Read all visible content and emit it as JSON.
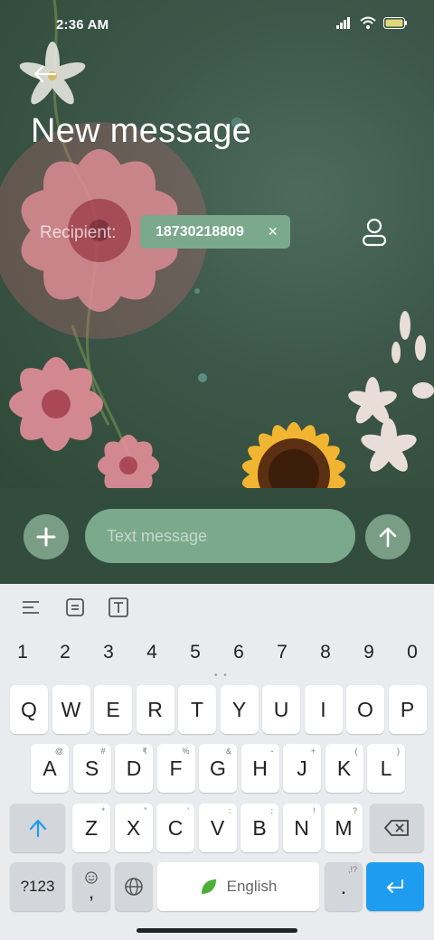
{
  "status_bar": {
    "time": "2:36 AM"
  },
  "header": {
    "title": "New message"
  },
  "recipient": {
    "label": "Recipient:",
    "chip_text": "18730218809",
    "chip_close": "×"
  },
  "compose": {
    "placeholder": "Text message"
  },
  "keyboard": {
    "numbers": [
      "1",
      "2",
      "3",
      "4",
      "5",
      "6",
      "7",
      "8",
      "9",
      "0"
    ],
    "row1": [
      "Q",
      "W",
      "E",
      "R",
      "T",
      "Y",
      "U",
      "I",
      "O",
      "P"
    ],
    "row2": [
      "A",
      "S",
      "D",
      "F",
      "G",
      "H",
      "J",
      "K",
      "L"
    ],
    "row2_hints": [
      "@",
      "#",
      "₹",
      "%",
      "&",
      "-",
      "+",
      "(",
      ")"
    ],
    "row3": [
      "Z",
      "X",
      "C",
      "V",
      "B",
      "N",
      "M"
    ],
    "row3_hints": [
      "*",
      "\"",
      "'",
      ":",
      ";",
      "!",
      "?"
    ],
    "symbols_key": "?123",
    "comma_key": ",",
    "period_key": ".",
    "period_hint": ",!?",
    "space_label": "English"
  },
  "colors": {
    "accent": "#7aa98b",
    "keyboard_bg": "#e9ebee",
    "enter_key": "#1e9cf0"
  },
  "icons": [
    "back-arrow-icon",
    "contact-icon",
    "plus-icon",
    "send-arrow-icon",
    "align-icon",
    "clipboard-icon",
    "text-box-icon",
    "shift-icon",
    "backspace-icon",
    "emoji-icon",
    "globe-icon",
    "leaf-icon",
    "enter-icon"
  ]
}
